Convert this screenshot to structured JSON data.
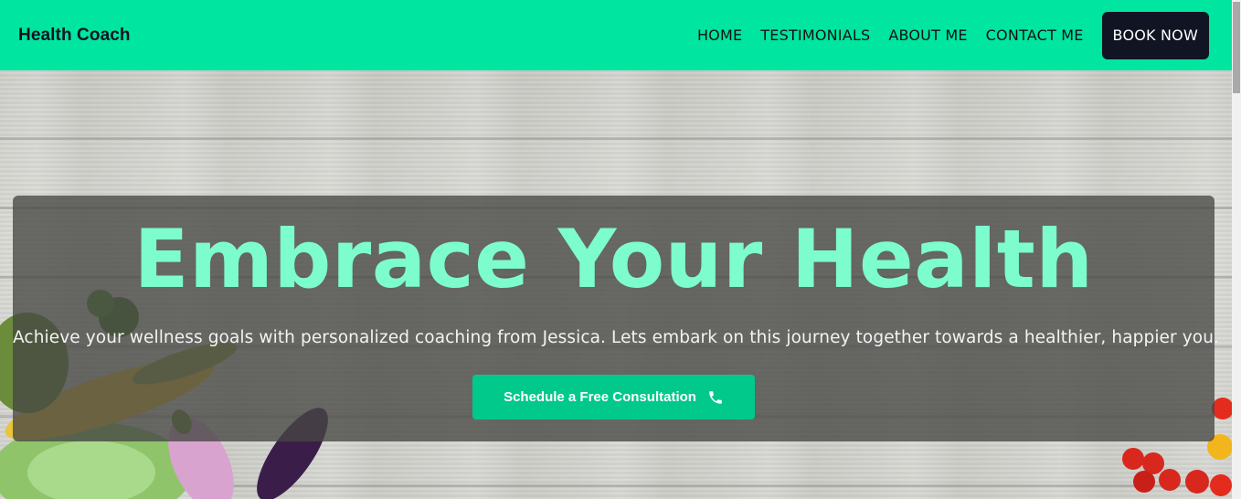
{
  "navbar": {
    "brand": "Health Coach",
    "links": [
      "HOME",
      "TESTIMONIALS",
      "ABOUT ME",
      "CONTACT ME"
    ],
    "book_label": "BOOK NOW",
    "bg_color": "#00e5a0"
  },
  "hero": {
    "title": "Embrace Your Health",
    "subtitle": "Achieve your wellness goals with personalized coaching from Jessica. Lets embark on this journey together towards a healthier, happier you.",
    "cta_label": "Schedule a Free Consultation",
    "cta_icon": "phone-icon",
    "title_color": "#7dfccd",
    "cta_color": "#00c98b"
  }
}
